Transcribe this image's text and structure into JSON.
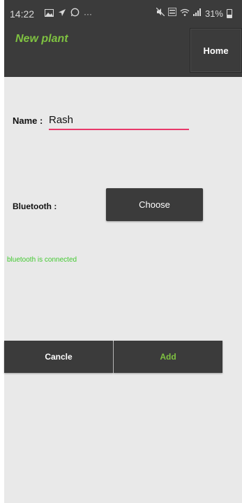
{
  "status_bar": {
    "time": "14:22",
    "left_icons": [
      "gallery-icon",
      "send-icon",
      "whatsapp-icon",
      "more-dots-icon"
    ],
    "right_icons": [
      "mute-icon",
      "volte-icon",
      "wifi-icon",
      "signal-icon",
      "battery-icon"
    ],
    "battery_percent": "31%"
  },
  "toolbar": {
    "title": "New plant",
    "home_label": "Home"
  },
  "form": {
    "name_label": "Name :",
    "name_value": "Rash",
    "bluetooth_label": "Bluetooth :",
    "choose_label": "Choose",
    "bluetooth_status": "bluetooth is connected"
  },
  "actions": {
    "cancel_label": "Cancle",
    "add_label": "Add"
  },
  "colors": {
    "appbar": "#3b3b3b",
    "background": "#e9e9e9",
    "accent_green": "#7fc241",
    "status_green": "#42c930",
    "input_underline": "#e8396a"
  }
}
